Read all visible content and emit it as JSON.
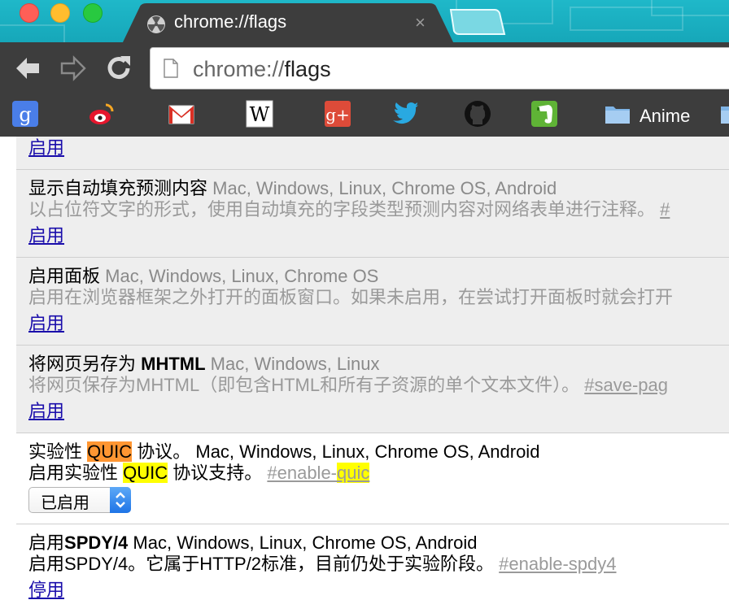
{
  "tab": {
    "title": "chrome://flags",
    "close_glyph": "×"
  },
  "omnibox": {
    "scheme": "chrome://",
    "path": "flags"
  },
  "bookmarks": {
    "items": [
      {
        "icon": "google-icon",
        "letter": "g"
      },
      {
        "icon": "weibo-icon"
      },
      {
        "icon": "gmail-icon"
      },
      {
        "icon": "wikipedia-icon",
        "letter": "W"
      },
      {
        "icon": "google-plus-icon",
        "letter": "g+"
      },
      {
        "icon": "twitter-icon"
      },
      {
        "icon": "github-icon"
      },
      {
        "icon": "evernote-icon"
      }
    ],
    "folder_label": "Anime"
  },
  "experiments": [
    {
      "action": "启用"
    },
    {
      "name": "显示自动填充预测内容",
      "platforms": "Mac, Windows, Linux, Chrome OS, Android",
      "description": "以占位符文字的形式，使用自动填充的字段类型预测内容对网络表单进行注释。",
      "permalink": "#",
      "action": "启用"
    },
    {
      "name": "启用面板",
      "platforms": "Mac, Windows, Linux, Chrome OS",
      "description": "启用在浏览器框架之外打开的面板窗口。如果未启用，在尝试打开面板时就会打开",
      "action": "启用"
    },
    {
      "name_prefix": "将网页另存为 ",
      "name_bold": "MHTML",
      "platforms": "Mac, Windows, Linux",
      "description": "将网页保存为MHTML（即包含HTML和所有子资源的单个文本文件）。",
      "permalink": "#save-pag",
      "action": "启用"
    },
    {
      "name_prefix": "实验性 ",
      "name_highlight": "QUIC",
      "name_suffix": " 协议。",
      "platforms": "Mac, Windows, Linux, Chrome OS, Android",
      "description_prefix": "启用实验性 ",
      "description_highlight": "QUIC",
      "description_suffix": " 协议支持。",
      "permalink_prefix": "#enable-",
      "permalink_highlight": "quic",
      "select_value": "已启用"
    },
    {
      "name_prefix": "启用",
      "name_bold": "SPDY/4",
      "platforms": "Mac, Windows, Linux, Chrome OS, Android",
      "description": "启用SPDY/4。它属于HTTP/2标准，目前仍处于实验阶段。",
      "permalink": "#enable-spdy4",
      "action": "停用"
    }
  ]
}
